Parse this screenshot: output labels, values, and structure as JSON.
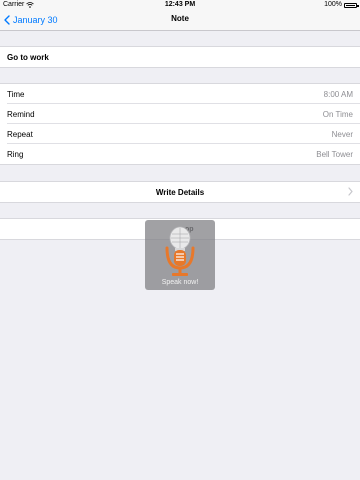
{
  "status_bar": {
    "carrier": "Carrier",
    "time": "12:43 PM",
    "battery": "100%"
  },
  "nav": {
    "back_label": "January 30",
    "title": "Note"
  },
  "note_title": "Go to work",
  "settings": [
    {
      "label": "Time",
      "value": "8:00 AM"
    },
    {
      "label": "Remind",
      "value": "On Time"
    },
    {
      "label": "Repeat",
      "value": "Never"
    },
    {
      "label": "Ring",
      "value": "Bell Tower"
    }
  ],
  "write_details_label": "Write Details",
  "voice_overlay": {
    "text": "Speak now!",
    "peek_text": "op"
  },
  "colors": {
    "accent": "#007aff",
    "background": "#efeff4",
    "mic_orange": "#e8782a"
  },
  "icons": {
    "back": "chevron-left-icon",
    "disclosure": "chevron-right-icon",
    "mic": "microphone-icon",
    "wifi": "wifi-icon",
    "battery": "battery-icon"
  }
}
